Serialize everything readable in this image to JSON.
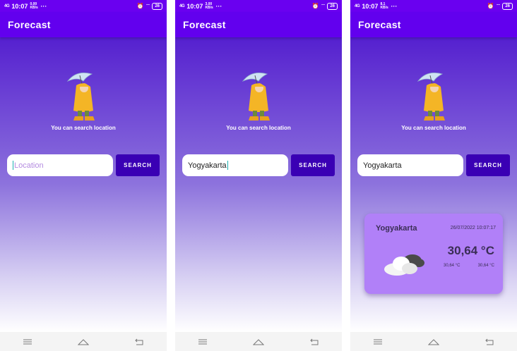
{
  "status_bar": {
    "network": "4G",
    "time": "10:07",
    "speeds": [
      "0.00 KB/s",
      "3.00 KB/s",
      "8.1 KB/s"
    ],
    "more": "···",
    "battery": "26"
  },
  "app": {
    "title": "Forecast"
  },
  "caption": "You can search location",
  "search": {
    "placeholder": "Location",
    "values": [
      "",
      "Yogyakarta",
      "Yogyakarta"
    ],
    "button_label": "SEARCH"
  },
  "weather_card": {
    "city": "Yogyakarta",
    "datetime": "26/07/2022 10:07:17",
    "temperature": "30,64 °C",
    "temp_min": "30,64 °C",
    "temp_max": "30,64 °C",
    "icon": "cloud-icon"
  },
  "colors": {
    "app_bar": "#6200ee",
    "status_bar": "#6a00f0",
    "button": "#3a00b4",
    "card": "#b180f8",
    "gradient_top": "#5520cf"
  },
  "nav_icons": [
    "menu-icon",
    "home-icon",
    "back-icon"
  ]
}
